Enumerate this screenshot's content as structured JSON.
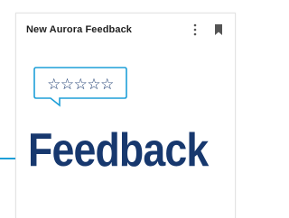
{
  "card": {
    "title": "New Aurora Feedback",
    "more_icon": "more-vertical-icon",
    "bookmark_icon": "bookmark-icon"
  },
  "thumbnail": {
    "rating_stars": "☆☆☆☆☆",
    "heading": "Feedback"
  },
  "colors": {
    "brand_navy": "#17386e",
    "accent_blue": "#1e9fd8",
    "title_text": "#1f1f1f",
    "icon_gray": "#555555"
  }
}
